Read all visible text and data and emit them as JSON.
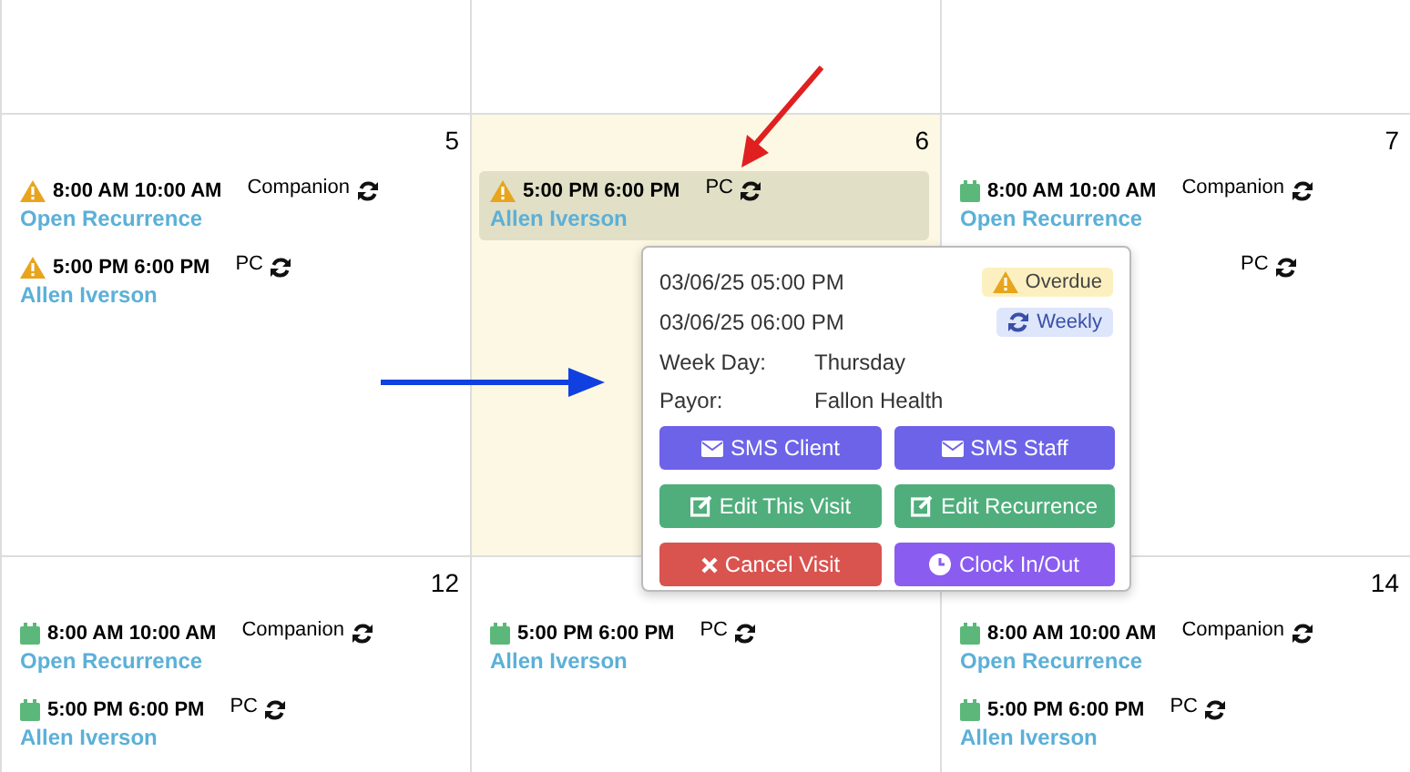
{
  "calendar": {
    "weeks": [
      {
        "days": [
          {
            "selected": false
          },
          {
            "selected": false
          },
          {
            "selected": false
          }
        ]
      },
      {
        "days": [
          {
            "number": "5",
            "selected": false,
            "events": [
              {
                "kind": "overdue",
                "time": "8:00 AM 10:00 AM",
                "type": "Companion",
                "client": "Open Recurrence",
                "selected": false
              },
              {
                "kind": "overdue",
                "time": "5:00 PM 6:00 PM",
                "type": "PC",
                "client": "Allen Iverson",
                "selected": false
              }
            ]
          },
          {
            "number": "6",
            "selected": true,
            "events": [
              {
                "kind": "overdue",
                "time": "5:00 PM 6:00 PM",
                "type": "PC",
                "client": "Allen Iverson",
                "selected": true
              }
            ]
          },
          {
            "number": "7",
            "selected": false,
            "events": [
              {
                "kind": "scheduled",
                "time": "8:00 AM 10:00 AM",
                "type": "Companion",
                "client": "Open Recurrence",
                "selected": false
              },
              {
                "kind": "covered",
                "type": "PC",
                "selected": false
              }
            ]
          }
        ]
      },
      {
        "days": [
          {
            "number": "12",
            "selected": false,
            "events": [
              {
                "kind": "scheduled",
                "time": "8:00 AM 10:00 AM",
                "type": "Companion",
                "client": "Open Recurrence",
                "selected": false
              },
              {
                "kind": "scheduled",
                "time": "5:00 PM 6:00 PM",
                "type": "PC",
                "client": "Allen Iverson",
                "selected": false
              }
            ]
          },
          {
            "selected": false,
            "events": [
              {
                "kind": "scheduled",
                "time": "5:00 PM 6:00 PM",
                "type": "PC",
                "client": "Allen Iverson",
                "selected": false
              }
            ]
          },
          {
            "number": "14",
            "selected": false,
            "events": [
              {
                "kind": "scheduled",
                "time": "8:00 AM 10:00 AM",
                "type": "Companion",
                "client": "Open Recurrence",
                "selected": false
              },
              {
                "kind": "scheduled",
                "time": "5:00 PM 6:00 PM",
                "type": "PC",
                "client": "Allen Iverson",
                "selected": false
              }
            ]
          }
        ]
      }
    ]
  },
  "popover": {
    "start": "03/06/25 05:00 PM",
    "end": "03/06/25 06:00 PM",
    "status_badge": "Overdue",
    "recurrence_badge": "Weekly",
    "fields": [
      {
        "label": "Week Day:",
        "value": "Thursday"
      },
      {
        "label": "Payor:",
        "value": "Fallon Health"
      }
    ],
    "buttons": [
      {
        "kind": "sms",
        "label": "SMS Client"
      },
      {
        "kind": "sms",
        "label": "SMS Staff"
      },
      {
        "kind": "edit",
        "label": "Edit This Visit"
      },
      {
        "kind": "edit",
        "label": "Edit Recurrence"
      },
      {
        "kind": "cancel",
        "label": "Cancel Visit"
      },
      {
        "kind": "clock",
        "label": "Clock In/Out"
      }
    ]
  }
}
